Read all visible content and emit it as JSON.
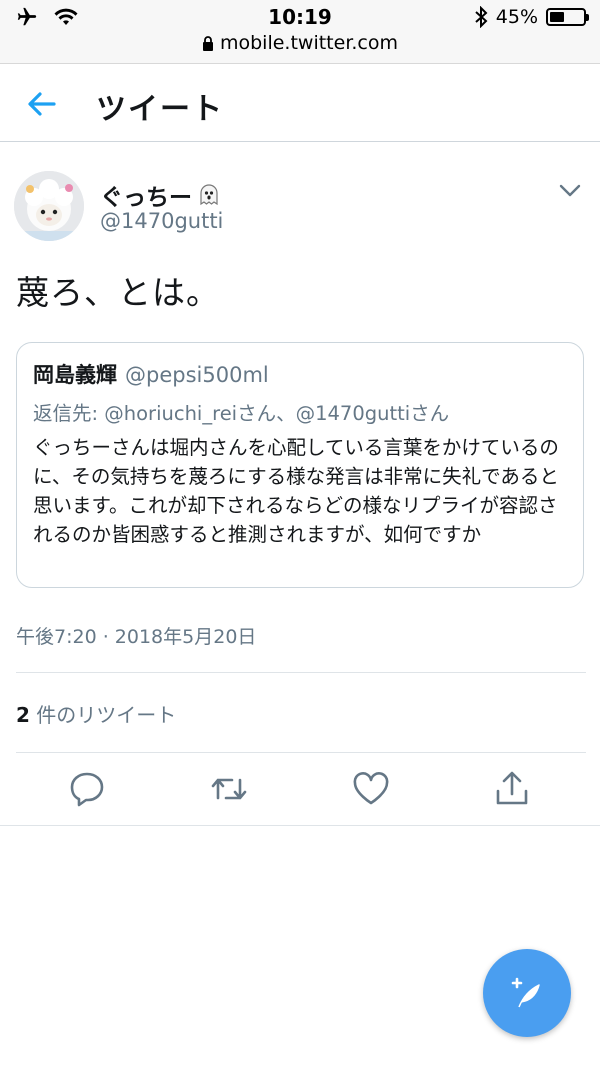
{
  "status_bar": {
    "time": "10:19",
    "battery": "45%",
    "battery_level": 0.45,
    "url": "mobile.twitter.com"
  },
  "header": {
    "title": "ツイート"
  },
  "tweet": {
    "user_name": "ぐっちー",
    "user_handle": "@1470gutti",
    "text": "蔑ろ、とは。",
    "timestamp": "午後7:20 · 2018年5月20日",
    "retweet_count": "2",
    "retweet_label": " 件のリツイート"
  },
  "quoted_tweet": {
    "name": "岡島義輝",
    "handle": "@pepsi500ml",
    "reply_to": "返信先: @horiuchi_reiさん、@1470guttiさん",
    "text": "ぐっちーさんは堀内さんを心配している言葉をかけているのに、その気持ちを蔑ろにする様な発言は非常に失礼であると思います。これが却下されるならどの様なリプライが容認されるのか皆困惑すると推測されますが、如何ですか"
  },
  "colors": {
    "accent": "#1da1f2",
    "fab": "#4a9ef0",
    "secondary_text": "#657786"
  }
}
